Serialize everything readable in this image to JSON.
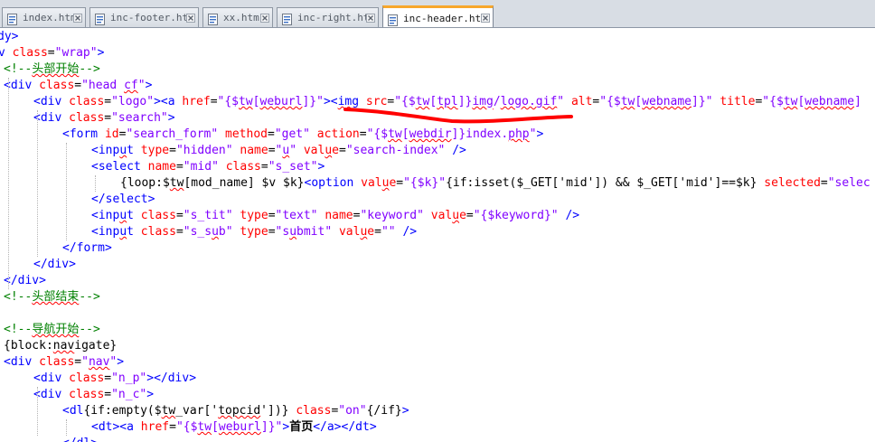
{
  "tabs": [
    {
      "label": "index.htm",
      "active": false
    },
    {
      "label": "inc-footer.htm",
      "active": false
    },
    {
      "label": "xx.htm",
      "active": false
    },
    {
      "label": "inc-right.htm",
      "active": false
    },
    {
      "label": "inc-header.htm",
      "active": true
    }
  ],
  "editor": {
    "lines": [
      {
        "tokens": [
          {
            "t": "tag",
            "v": "dy>"
          }
        ]
      },
      {
        "tokens": [
          {
            "t": "tag",
            "v": "v "
          },
          {
            "t": "attr",
            "v": "class"
          },
          {
            "t": "txt",
            "v": "="
          },
          {
            "t": "val",
            "v": "\"wrap\""
          },
          {
            "t": "tag",
            "v": ">"
          }
        ]
      },
      {
        "tokens": [
          {
            "t": "com",
            "v": "<!--头部开始-->"
          }
        ]
      },
      {
        "tokens": [
          {
            "t": "tag",
            "v": "<div "
          },
          {
            "t": "attr",
            "v": "class"
          },
          {
            "t": "txt",
            "v": "="
          },
          {
            "t": "val",
            "v": "\"head cf\""
          },
          {
            "t": "tag",
            "v": ">"
          }
        ]
      },
      {
        "tokens": [
          {
            "t": "tag",
            "v": "<div "
          },
          {
            "t": "attr",
            "v": "class"
          },
          {
            "t": "txt",
            "v": "="
          },
          {
            "t": "val",
            "v": "\"logo\""
          },
          {
            "t": "tag",
            "v": "><a "
          },
          {
            "t": "attr",
            "v": "href"
          },
          {
            "t": "txt",
            "v": "="
          },
          {
            "t": "val",
            "v": "\"{$tw[weburl]}\""
          },
          {
            "t": "tag",
            "v": "><img "
          },
          {
            "t": "attr",
            "v": "src"
          },
          {
            "t": "txt",
            "v": "="
          },
          {
            "t": "val",
            "v": "\"{$tw[tpl]}img/logo.gif\""
          },
          {
            "t": "txt",
            "v": " "
          },
          {
            "t": "attr",
            "v": "alt"
          },
          {
            "t": "txt",
            "v": "="
          },
          {
            "t": "val",
            "v": "\"{$tw[webname]}\""
          },
          {
            "t": "txt",
            "v": " "
          },
          {
            "t": "attr",
            "v": "title"
          },
          {
            "t": "txt",
            "v": "="
          },
          {
            "t": "val",
            "v": "\"{$tw[webname]"
          }
        ]
      },
      {
        "tokens": [
          {
            "t": "tag",
            "v": "<div "
          },
          {
            "t": "attr",
            "v": "class"
          },
          {
            "t": "txt",
            "v": "="
          },
          {
            "t": "val",
            "v": "\"search\""
          },
          {
            "t": "tag",
            "v": ">"
          }
        ]
      },
      {
        "tokens": [
          {
            "t": "tag",
            "v": "<form "
          },
          {
            "t": "attr",
            "v": "id"
          },
          {
            "t": "txt",
            "v": "="
          },
          {
            "t": "val",
            "v": "\"search_form\""
          },
          {
            "t": "txt",
            "v": " "
          },
          {
            "t": "attr",
            "v": "method"
          },
          {
            "t": "txt",
            "v": "="
          },
          {
            "t": "val",
            "v": "\"get\""
          },
          {
            "t": "txt",
            "v": " "
          },
          {
            "t": "attr",
            "v": "action"
          },
          {
            "t": "txt",
            "v": "="
          },
          {
            "t": "val",
            "v": "\"{$tw[webdir]}index.php\""
          },
          {
            "t": "tag",
            "v": ">"
          }
        ]
      },
      {
        "tokens": [
          {
            "t": "tag",
            "v": "<input "
          },
          {
            "t": "attr",
            "v": "type"
          },
          {
            "t": "txt",
            "v": "="
          },
          {
            "t": "val",
            "v": "\"hidden\""
          },
          {
            "t": "txt",
            "v": " "
          },
          {
            "t": "attr",
            "v": "name"
          },
          {
            "t": "txt",
            "v": "="
          },
          {
            "t": "val",
            "v": "\"u\""
          },
          {
            "t": "txt",
            "v": " "
          },
          {
            "t": "attr",
            "v": "value"
          },
          {
            "t": "txt",
            "v": "="
          },
          {
            "t": "val",
            "v": "\"search-index\""
          },
          {
            "t": "txt",
            "v": " "
          },
          {
            "t": "tag",
            "v": "/>"
          }
        ]
      },
      {
        "tokens": [
          {
            "t": "tag",
            "v": "<select "
          },
          {
            "t": "attr",
            "v": "name"
          },
          {
            "t": "txt",
            "v": "="
          },
          {
            "t": "val",
            "v": "\"mid\""
          },
          {
            "t": "txt",
            "v": " "
          },
          {
            "t": "attr",
            "v": "class"
          },
          {
            "t": "txt",
            "v": "="
          },
          {
            "t": "val",
            "v": "\"s_set\""
          },
          {
            "t": "tag",
            "v": ">"
          }
        ]
      },
      {
        "tokens": [
          {
            "t": "txt",
            "v": "{loop:$tw[mod_name] $v $k}"
          },
          {
            "t": "tag",
            "v": "<option "
          },
          {
            "t": "attr",
            "v": "value"
          },
          {
            "t": "txt",
            "v": "="
          },
          {
            "t": "val",
            "v": "\"{$k}\""
          },
          {
            "t": "txt",
            "v": "{if:isset($_GET['mid']) && $_GET['mid']==$k} "
          },
          {
            "t": "attr",
            "v": "selected"
          },
          {
            "t": "txt",
            "v": "="
          },
          {
            "t": "val",
            "v": "\"selec"
          }
        ]
      },
      {
        "tokens": [
          {
            "t": "tag",
            "v": "</select>"
          }
        ]
      },
      {
        "tokens": [
          {
            "t": "tag",
            "v": "<input "
          },
          {
            "t": "attr",
            "v": "class"
          },
          {
            "t": "txt",
            "v": "="
          },
          {
            "t": "val",
            "v": "\"s_tit\""
          },
          {
            "t": "txt",
            "v": " "
          },
          {
            "t": "attr",
            "v": "type"
          },
          {
            "t": "txt",
            "v": "="
          },
          {
            "t": "val",
            "v": "\"text\""
          },
          {
            "t": "txt",
            "v": " "
          },
          {
            "t": "attr",
            "v": "name"
          },
          {
            "t": "txt",
            "v": "="
          },
          {
            "t": "val",
            "v": "\"keyword\""
          },
          {
            "t": "txt",
            "v": " "
          },
          {
            "t": "attr",
            "v": "value"
          },
          {
            "t": "txt",
            "v": "="
          },
          {
            "t": "val",
            "v": "\"{$keyword}\""
          },
          {
            "t": "txt",
            "v": " "
          },
          {
            "t": "tag",
            "v": "/>"
          }
        ]
      },
      {
        "tokens": [
          {
            "t": "tag",
            "v": "<input "
          },
          {
            "t": "attr",
            "v": "class"
          },
          {
            "t": "txt",
            "v": "="
          },
          {
            "t": "val",
            "v": "\"s_sub\""
          },
          {
            "t": "txt",
            "v": " "
          },
          {
            "t": "attr",
            "v": "type"
          },
          {
            "t": "txt",
            "v": "="
          },
          {
            "t": "val",
            "v": "\"submit\""
          },
          {
            "t": "txt",
            "v": " "
          },
          {
            "t": "attr",
            "v": "value"
          },
          {
            "t": "txt",
            "v": "="
          },
          {
            "t": "val",
            "v": "\"\""
          },
          {
            "t": "txt",
            "v": " "
          },
          {
            "t": "tag",
            "v": "/>"
          }
        ]
      },
      {
        "tokens": [
          {
            "t": "tag",
            "v": "</form>"
          }
        ]
      },
      {
        "tokens": [
          {
            "t": "tag",
            "v": "</div>"
          }
        ]
      },
      {
        "tokens": [
          {
            "t": "tag",
            "v": "</div>"
          }
        ]
      },
      {
        "tokens": [
          {
            "t": "com",
            "v": "<!--头部结束-->"
          }
        ]
      },
      {
        "tokens": []
      },
      {
        "tokens": [
          {
            "t": "com",
            "v": "<!--导航开始-->"
          }
        ]
      },
      {
        "tokens": [
          {
            "t": "txt",
            "v": "{block:navigate}"
          }
        ]
      },
      {
        "tokens": [
          {
            "t": "tag",
            "v": "<div "
          },
          {
            "t": "attr",
            "v": "class"
          },
          {
            "t": "txt",
            "v": "="
          },
          {
            "t": "val",
            "v": "\"nav\""
          },
          {
            "t": "tag",
            "v": ">"
          }
        ]
      },
      {
        "tokens": [
          {
            "t": "tag",
            "v": "<div "
          },
          {
            "t": "attr",
            "v": "class"
          },
          {
            "t": "txt",
            "v": "="
          },
          {
            "t": "val",
            "v": "\"n_p\""
          },
          {
            "t": "tag",
            "v": "></div>"
          }
        ]
      },
      {
        "tokens": [
          {
            "t": "tag",
            "v": "<div "
          },
          {
            "t": "attr",
            "v": "class"
          },
          {
            "t": "txt",
            "v": "="
          },
          {
            "t": "val",
            "v": "\"n_c\""
          },
          {
            "t": "tag",
            "v": ">"
          }
        ]
      },
      {
        "tokens": [
          {
            "t": "tag",
            "v": "<dl"
          },
          {
            "t": "txt",
            "v": "{if:empty($tw_var['topcid'])} "
          },
          {
            "t": "attr",
            "v": "class"
          },
          {
            "t": "txt",
            "v": "="
          },
          {
            "t": "val",
            "v": "\"on\""
          },
          {
            "t": "txt",
            "v": "{/if}"
          },
          {
            "t": "tag",
            "v": ">"
          }
        ]
      },
      {
        "tokens": [
          {
            "t": "tag",
            "v": "<dt><a "
          },
          {
            "t": "attr",
            "v": "href"
          },
          {
            "t": "txt",
            "v": "="
          },
          {
            "t": "val",
            "v": "\"{$tw[weburl]}\""
          },
          {
            "t": "tag",
            "v": ">"
          },
          {
            "t": "bold",
            "v": "首页"
          },
          {
            "t": "tag",
            "v": "</a></dt>"
          }
        ]
      },
      {
        "tokens": [
          {
            "t": "tag",
            "v": "</dl>"
          }
        ]
      }
    ]
  },
  "colors": {
    "tag": "#0000ff",
    "attribute": "#ff0000",
    "value": "#8000ff",
    "comment": "#008000",
    "annotation": "#ff0000",
    "active_tab_accent": "#f7a72c"
  }
}
